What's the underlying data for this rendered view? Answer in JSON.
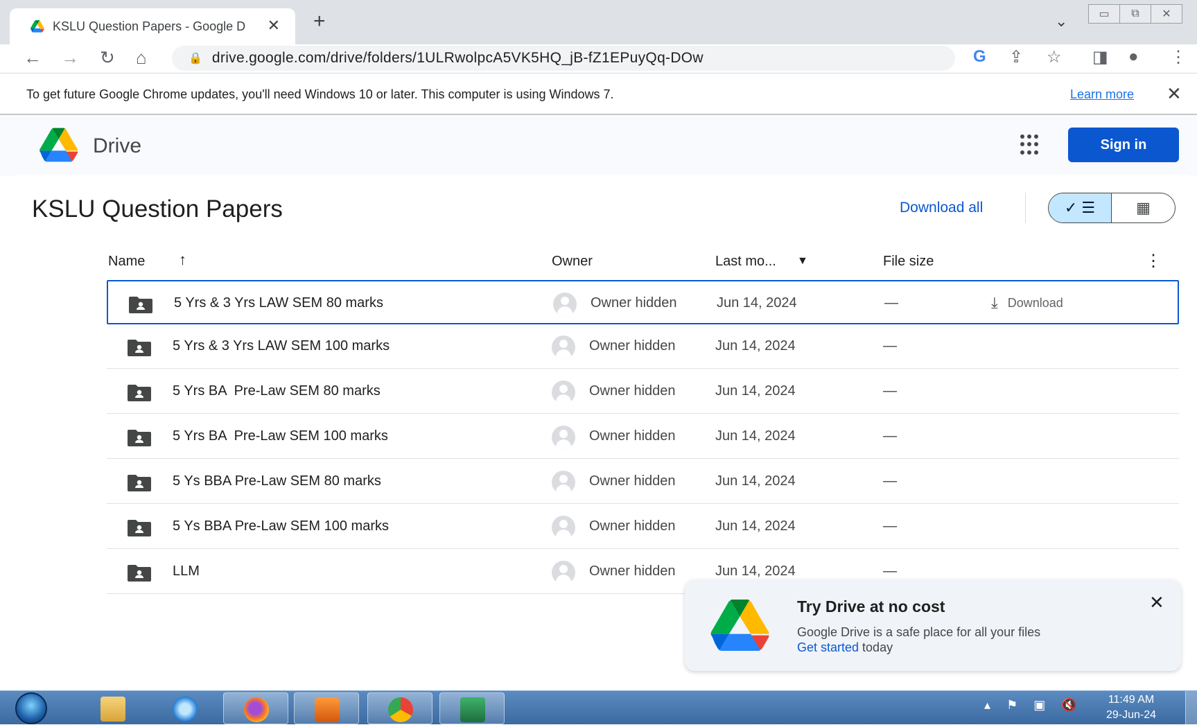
{
  "browser": {
    "tab_title": "KSLU Question Papers - Google D",
    "url": "drive.google.com/drive/folders/1ULRwolpcA5VK5HQ_jB-fZ1EPuyQq-DOw"
  },
  "infobar": {
    "message": "To get future Google Chrome updates, you'll need Windows 10 or later. This computer is using Windows 7.",
    "learn_more": "Learn more"
  },
  "drive": {
    "app_name": "Drive",
    "sign_in": "Sign in",
    "folder_title": "KSLU Question Papers",
    "download_all": "Download all"
  },
  "table": {
    "columns": {
      "name": "Name",
      "owner": "Owner",
      "last_modified": "Last mo...",
      "file_size": "File size"
    },
    "download_label": "Download",
    "rows": [
      {
        "name": "5 Yrs & 3 Yrs LAW SEM 80 marks",
        "owner": "Owner hidden",
        "modified": "Jun 14, 2024",
        "size": "—"
      },
      {
        "name": "5 Yrs & 3 Yrs LAW SEM 100 marks",
        "owner": "Owner hidden",
        "modified": "Jun 14, 2024",
        "size": "—"
      },
      {
        "name": "5 Yrs BA  Pre-Law SEM 80 marks",
        "owner": "Owner hidden",
        "modified": "Jun 14, 2024",
        "size": "—"
      },
      {
        "name": "5 Yrs BA  Pre-Law SEM 100 marks",
        "owner": "Owner hidden",
        "modified": "Jun 14, 2024",
        "size": "—"
      },
      {
        "name": "5 Ys BBA Pre-Law SEM 80 marks",
        "owner": "Owner hidden",
        "modified": "Jun 14, 2024",
        "size": "—"
      },
      {
        "name": "5 Ys BBA Pre-Law SEM 100 marks",
        "owner": "Owner hidden",
        "modified": "Jun 14, 2024",
        "size": "—"
      },
      {
        "name": "LLM",
        "owner": "Owner hidden",
        "modified": "Jun 14, 2024",
        "size": "—"
      }
    ]
  },
  "promo": {
    "title": "Try Drive at no cost",
    "body": "Google Drive is a safe place for all your files",
    "link": "Get started",
    "suffix": " today"
  },
  "taskbar": {
    "time": "11:49 AM",
    "date": "29-Jun-24"
  },
  "colors": {
    "accent": "#0b57d0",
    "drive_green": "#0f9d58",
    "drive_yellow": "#f4b400",
    "drive_blue": "#4285f4"
  }
}
